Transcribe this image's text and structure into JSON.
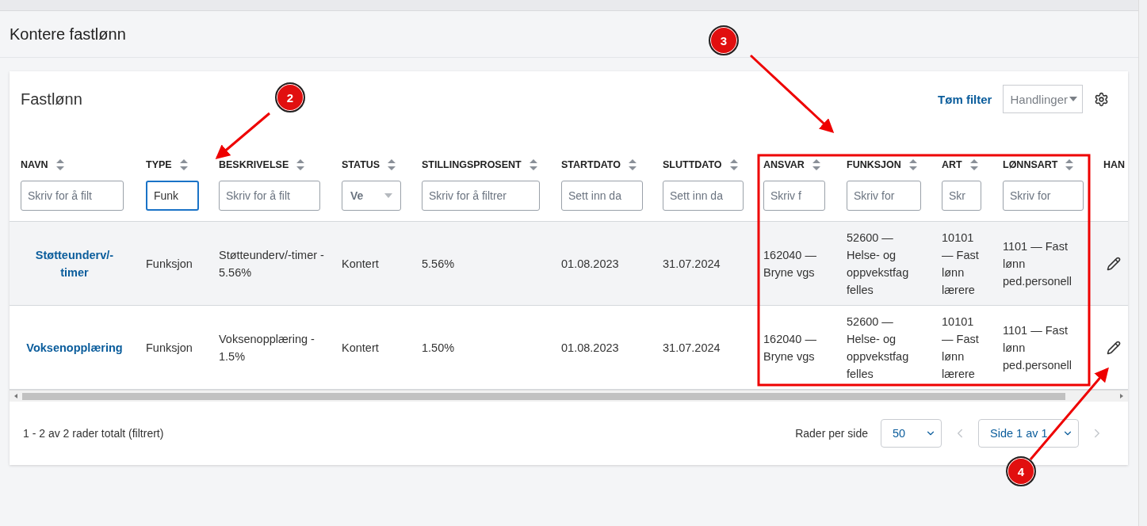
{
  "page": {
    "title": "Kontere fastlønn"
  },
  "card": {
    "title": "Fastlønn",
    "clear_filter": "Tøm filter",
    "actions": {
      "label": "Handlinger"
    }
  },
  "table": {
    "columns": [
      {
        "label": "NAVN",
        "filter": {
          "kind": "text",
          "placeholder": "Skriv for å filt",
          "focused": false
        }
      },
      {
        "label": "TYPE",
        "filter": {
          "kind": "text",
          "value": "Funk",
          "focused": true
        }
      },
      {
        "label": "BESKRIVELSE",
        "filter": {
          "kind": "text",
          "placeholder": "Skriv for å filt",
          "focused": false
        }
      },
      {
        "label": "STATUS",
        "filter": {
          "kind": "select",
          "placeholder": "Ve",
          "focused": false
        }
      },
      {
        "label": "STILLINGSPROSENT",
        "filter": {
          "kind": "text",
          "placeholder": "Skriv for å filtrer",
          "focused": false
        }
      },
      {
        "label": "STARTDATO",
        "filter": {
          "kind": "date",
          "placeholder": "Sett inn da",
          "focused": false
        }
      },
      {
        "label": "SLUTTDATO",
        "filter": {
          "kind": "date",
          "placeholder": "Sett inn da",
          "focused": false
        }
      },
      {
        "label": "ANSVAR",
        "filter": {
          "kind": "text",
          "placeholder": "Skriv f",
          "focused": false
        }
      },
      {
        "label": "FUNKSJON",
        "filter": {
          "kind": "text",
          "placeholder": "Skriv for",
          "focused": false
        }
      },
      {
        "label": "ART",
        "filter": {
          "kind": "text",
          "placeholder": "Skr",
          "focused": false
        }
      },
      {
        "label": "LØNNSART",
        "filter": {
          "kind": "text",
          "placeholder": "Skriv for",
          "focused": false
        }
      },
      {
        "label": "HAN"
      }
    ],
    "rows": [
      {
        "selected": true,
        "cells": [
          "Støtteunderv/-timer",
          "Funksjon",
          "Støtteunderv/-timer - 5.56%",
          "Kontert",
          "5.56%",
          "01.08.2023",
          "31.07.2024",
          "162040 — Bryne vgs",
          "52600 — Helse- og oppvekstfag felles",
          "10101 — Fast lønn lærere",
          "1101 — Fast lønn ped.personell"
        ]
      },
      {
        "selected": false,
        "cells": [
          "Voksenopplæring",
          "Funksjon",
          "Voksenopplæring - 1.5%",
          "Kontert",
          "1.50%",
          "01.08.2023",
          "31.07.2024",
          "162040 — Bryne vgs",
          "52600 — Helse- og oppvekstfag felles",
          "10101 — Fast lønn lærere",
          "1101 — Fast lønn ped.personell"
        ]
      }
    ]
  },
  "footer": {
    "summary": "1 - 2 av 2 rader totalt (filtrert)",
    "rows_per_page_label": "Rader per side",
    "rows_per_page": "50",
    "page_select": "Side 1 av 1",
    "prev": {
      "disabled": true
    },
    "next": {
      "disabled": true
    }
  },
  "annotations": [
    {
      "label": "2"
    },
    {
      "label": "3"
    },
    {
      "label": "4"
    }
  ]
}
